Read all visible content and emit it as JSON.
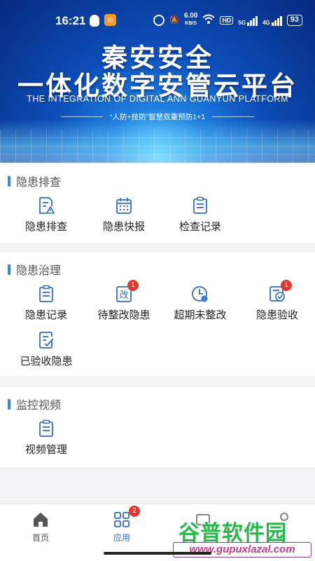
{
  "status_bar": {
    "time": "16:21",
    "speed_value": "6.00",
    "speed_unit": "KB/S",
    "hd": "HD",
    "net1": "5G",
    "net2": "4G",
    "battery": "93"
  },
  "banner": {
    "title_line1": "秦安安全",
    "title_line2": "一体化数字安管云平台",
    "subtitle": "THE INTEGRATION OF DIGITAL ANN GUANYUN PLATFORM",
    "tagline": "“人防+技防”智慧双重预防1+1"
  },
  "sections": {
    "hazard_check": {
      "title": "隐患排查",
      "items": [
        {
          "label": "隐患排查",
          "icon": "checklist-warning-icon"
        },
        {
          "label": "隐患快报",
          "icon": "calendar-icon"
        },
        {
          "label": "检查记录",
          "icon": "clipboard-icon"
        }
      ]
    },
    "hazard_governance": {
      "title": "隐患治理",
      "items": [
        {
          "label": "隐患记录",
          "icon": "clipboard-icon"
        },
        {
          "label": "待整改隐患",
          "icon": "rectify-icon",
          "badge": "1"
        },
        {
          "label": "超期未整改",
          "icon": "clock-icon"
        },
        {
          "label": "隐患验收",
          "icon": "accept-icon",
          "badge": "1"
        },
        {
          "label": "已验收隐患",
          "icon": "checked-doc-icon"
        }
      ]
    },
    "video": {
      "title": "监控视频",
      "items": [
        {
          "label": "视频管理",
          "icon": "clipboard-icon"
        }
      ]
    }
  },
  "bottom_nav": {
    "home": "首页",
    "apps": "应用",
    "apps_badge": "2"
  },
  "watermark": {
    "cn": "谷普软件园",
    "en": "www.gupuxlazal.com"
  },
  "colors": {
    "accent": "#3a86e8",
    "badge": "#e2372f",
    "icon": "#2f6fc4"
  }
}
